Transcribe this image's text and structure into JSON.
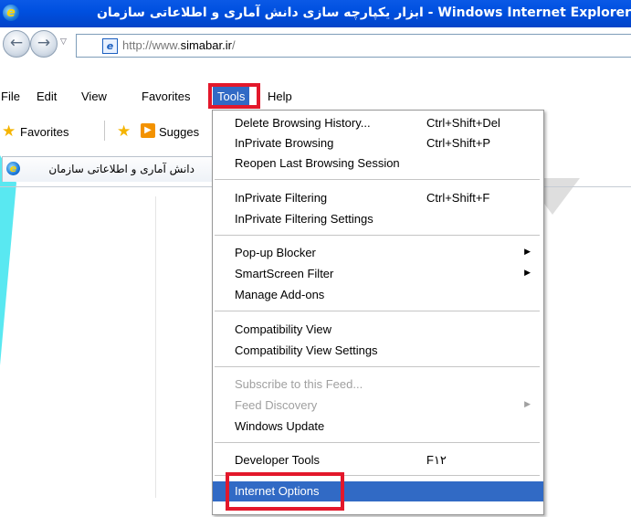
{
  "window": {
    "title": "ابزار یکپارچه سازی دانش آماری و اطلاعاتی سازمان - Windows Internet Explorer"
  },
  "address": {
    "url_prefix": "http://www.",
    "url_domain": "simabar.ir",
    "url_suffix": "/"
  },
  "menu_bar": {
    "items": [
      "File",
      "Edit",
      "View",
      "Favorites",
      "Tools",
      "Help"
    ],
    "active": "Tools"
  },
  "favorites_bar": {
    "favorites_label": "Favorites",
    "suggested_label": "Sugges"
  },
  "tab": {
    "title": "دانش آماری و اطلاعاتی سازمان"
  },
  "tools_menu": {
    "items": [
      {
        "label": "Delete Browsing History...",
        "shortcut": "Ctrl+Shift+Del"
      },
      {
        "label": "InPrivate Browsing",
        "shortcut": "Ctrl+Shift+P"
      },
      {
        "label": "Reopen Last Browsing Session",
        "shortcut": ""
      },
      {
        "label": "InPrivate Filtering",
        "shortcut": "Ctrl+Shift+F"
      },
      {
        "label": "InPrivate Filtering Settings",
        "shortcut": ""
      },
      {
        "label": "Pop-up Blocker",
        "shortcut": ""
      },
      {
        "label": "SmartScreen Filter",
        "shortcut": ""
      },
      {
        "label": "Manage Add-ons",
        "shortcut": ""
      },
      {
        "label": "Compatibility View",
        "shortcut": ""
      },
      {
        "label": "Compatibility View Settings",
        "shortcut": ""
      },
      {
        "label": "Subscribe to this Feed...",
        "shortcut": ""
      },
      {
        "label": "Feed Discovery",
        "shortcut": ""
      },
      {
        "label": "Windows Update",
        "shortcut": ""
      },
      {
        "label": "Developer Tools",
        "shortcut": "F۱۲"
      },
      {
        "label": "Internet Options",
        "shortcut": ""
      }
    ],
    "selected": "Internet Options"
  },
  "colors": {
    "titlebar": "#0050e0",
    "selection": "#316ac5",
    "highlight_box": "#e3182b"
  }
}
